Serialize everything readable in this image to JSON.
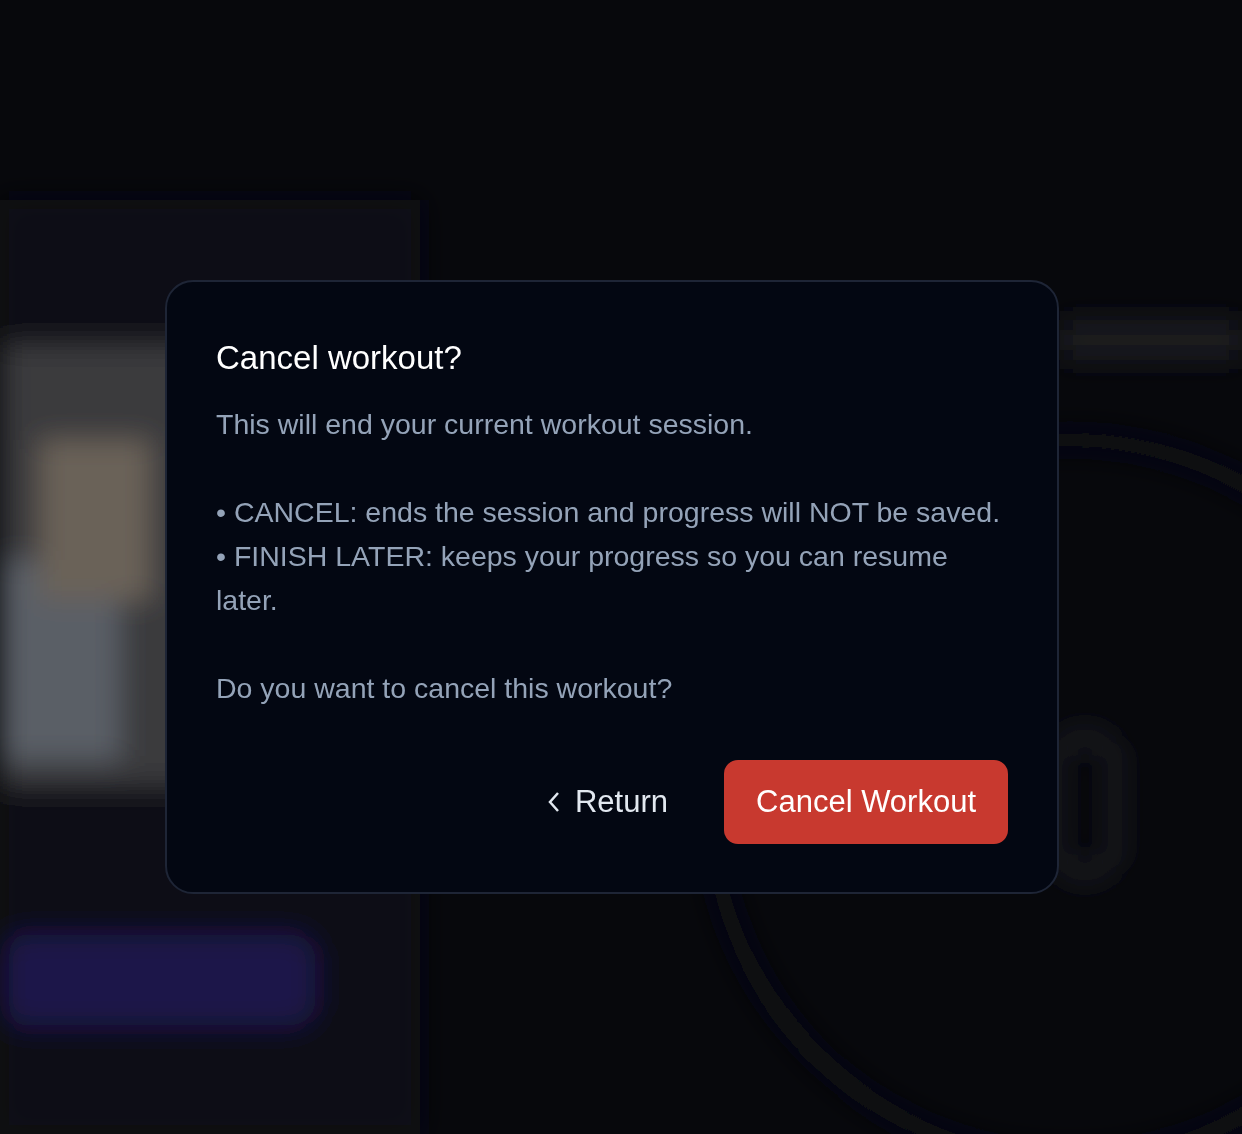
{
  "dialog": {
    "title": "Cancel workout?",
    "paragraphs": [
      [
        "This will end your current workout session."
      ],
      [
        "• CANCEL: ends the session and progress will NOT be saved.",
        "• FINISH LATER: keeps your progress so you can resume later."
      ],
      [
        "Do you want to cancel this workout?"
      ]
    ],
    "buttons": [
      {
        "label": "Return",
        "kind": "back"
      },
      {
        "label": "Cancel Workout",
        "kind": "danger"
      }
    ]
  }
}
